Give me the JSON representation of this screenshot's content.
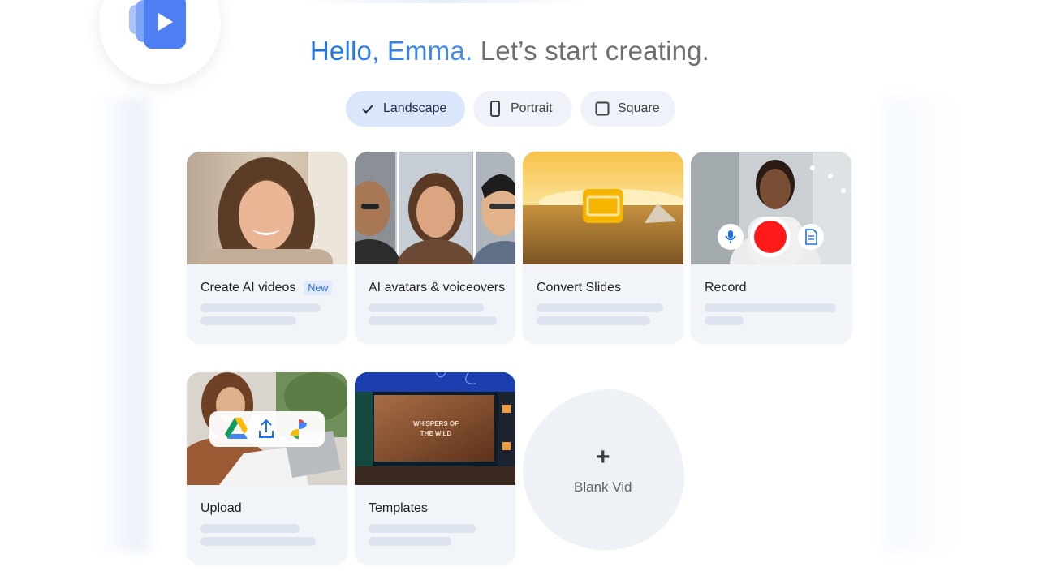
{
  "greeting": {
    "hello": "Hello, Emma.",
    "rest": " Let’s start creating."
  },
  "orientation": {
    "selected": "Landscape",
    "options": [
      {
        "label": "Landscape",
        "icon": "check-icon"
      },
      {
        "label": "Portrait",
        "icon": "portrait-icon"
      },
      {
        "label": "Square",
        "icon": "square-icon"
      }
    ]
  },
  "cards": [
    {
      "title": "Create AI videos",
      "badge": "New"
    },
    {
      "title": "AI avatars & voiceovers"
    },
    {
      "title": "Convert Slides"
    },
    {
      "title": "Record"
    },
    {
      "title": "Upload"
    },
    {
      "title": "Templates",
      "template_preview_text": "WHISPERS OF THE WILD"
    }
  ],
  "blank": {
    "plus": "+",
    "label": "Blank Vid"
  },
  "colors": {
    "accent": "#1a73e8",
    "record": "#ff1a1a",
    "card_bg": "#f1f4f9",
    "chip_selected": "#d9e6fb"
  }
}
